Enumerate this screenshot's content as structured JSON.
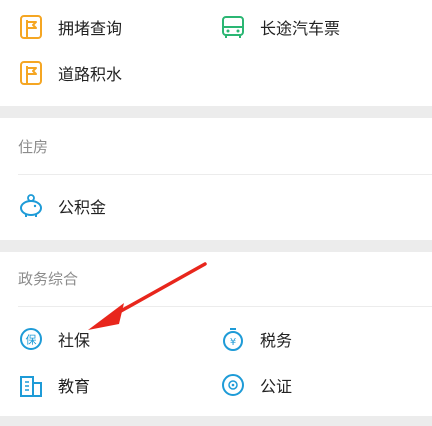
{
  "transport": {
    "items": [
      {
        "label": "拥堵查询",
        "icon": "traffic-sign-icon"
      },
      {
        "label": "长途汽车票",
        "icon": "bus-icon"
      },
      {
        "label": "道路积水",
        "icon": "traffic-sign-icon"
      }
    ]
  },
  "housing": {
    "title": "住房",
    "items": [
      {
        "label": "公积金",
        "icon": "piggy-bank-icon"
      }
    ]
  },
  "government": {
    "title": "政务综合",
    "items": [
      {
        "label": "社保",
        "icon": "social-security-icon"
      },
      {
        "label": "税务",
        "icon": "tax-icon"
      },
      {
        "label": "教育",
        "icon": "building-icon"
      },
      {
        "label": "公证",
        "icon": "notary-icon"
      }
    ]
  },
  "colors": {
    "orange": "#f5a623",
    "green": "#2bb673",
    "blue": "#1e9bd7",
    "arrow": "#e8261c"
  }
}
